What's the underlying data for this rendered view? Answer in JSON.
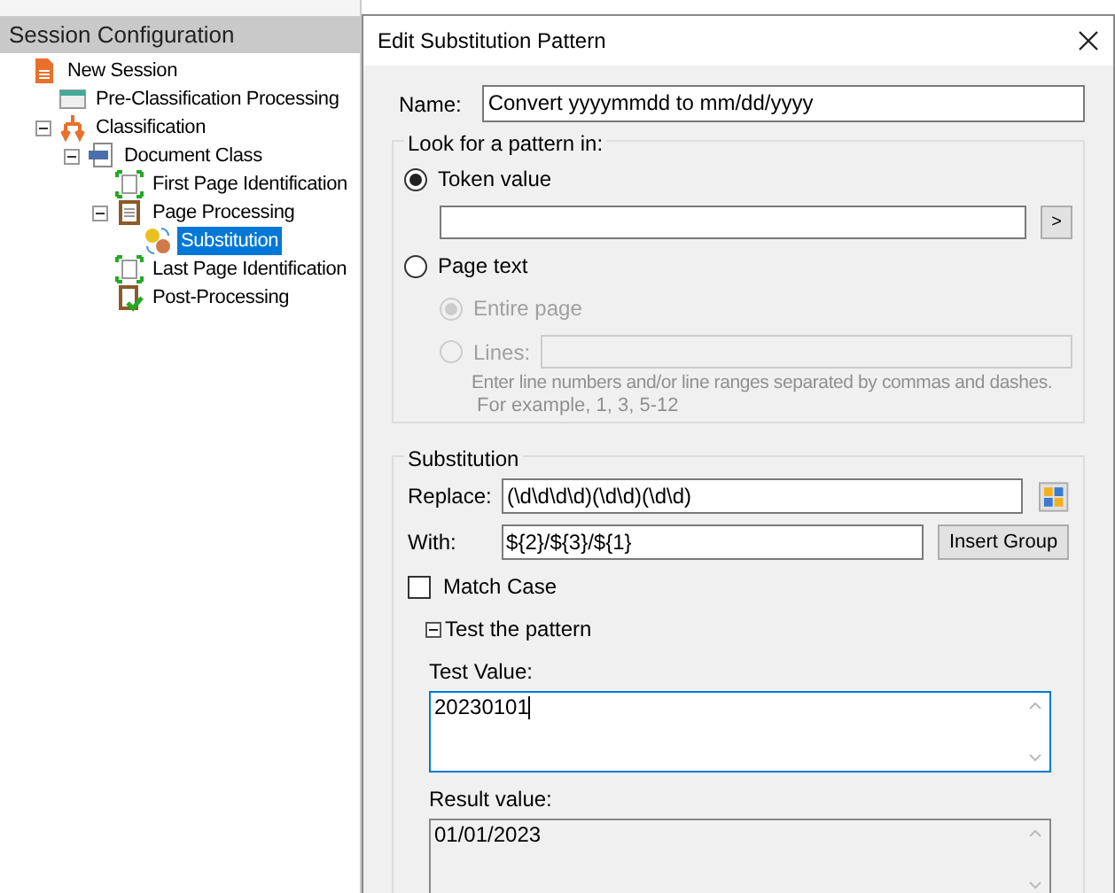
{
  "panel": {
    "title": "Session Configuration"
  },
  "tree": [
    {
      "label": "New Session",
      "kind": "session",
      "selected": false,
      "children": [
        {
          "label": "Pre-Classification Processing",
          "kind": "process",
          "selected": false
        },
        {
          "label": "Classification",
          "kind": "split",
          "selected": false,
          "expanded": true,
          "children": [
            {
              "label": "Document Class",
              "kind": "docclass",
              "selected": false,
              "expanded": true,
              "children": [
                {
                  "label": "First Page Identification",
                  "kind": "page",
                  "selected": false
                },
                {
                  "label": "Page Processing",
                  "kind": "clipboard",
                  "selected": false,
                  "expanded": true,
                  "children": [
                    {
                      "label": "Substitution",
                      "kind": "coins",
                      "selected": true
                    }
                  ]
                },
                {
                  "label": "Last Page Identification",
                  "kind": "page",
                  "selected": false
                },
                {
                  "label": "Post-Processing",
                  "kind": "check",
                  "selected": false
                }
              ]
            }
          ]
        }
      ]
    }
  ],
  "dialog": {
    "title": "Edit Substitution Pattern",
    "name_label": "Name:",
    "name_value": "Convert yyyymmdd to mm/dd/yyyy",
    "look": {
      "legend": "Look for a pattern in:",
      "options": [
        {
          "label": "Token value",
          "selected": true
        },
        {
          "label": "Page text",
          "selected": false
        }
      ],
      "token_button": ">",
      "sub_options": [
        {
          "label": "Entire page",
          "selected": true,
          "disabled": true
        },
        {
          "label": "Lines:",
          "selected": false,
          "disabled": true
        }
      ],
      "hint": "Enter line numbers and/or line ranges separated by commas and dashes.",
      "example": "For example, 1, 3, 5-12"
    },
    "substitution": {
      "legend": "Substitution",
      "replace_label": "Replace:",
      "replace_value": "(\\d\\d\\d\\d)(\\d\\d)(\\d\\d)",
      "with_label": "With:",
      "with_value": "${2}/${3}/${1}",
      "insert_button": "Insert Group",
      "match_case": {
        "label": "Match Case",
        "checked": false
      },
      "test": {
        "label": "Test the pattern",
        "expanded": true,
        "test_label": "Test Value:",
        "test_value": "20230101",
        "result_label": "Result value:",
        "result_value": "01/01/2023"
      }
    }
  }
}
